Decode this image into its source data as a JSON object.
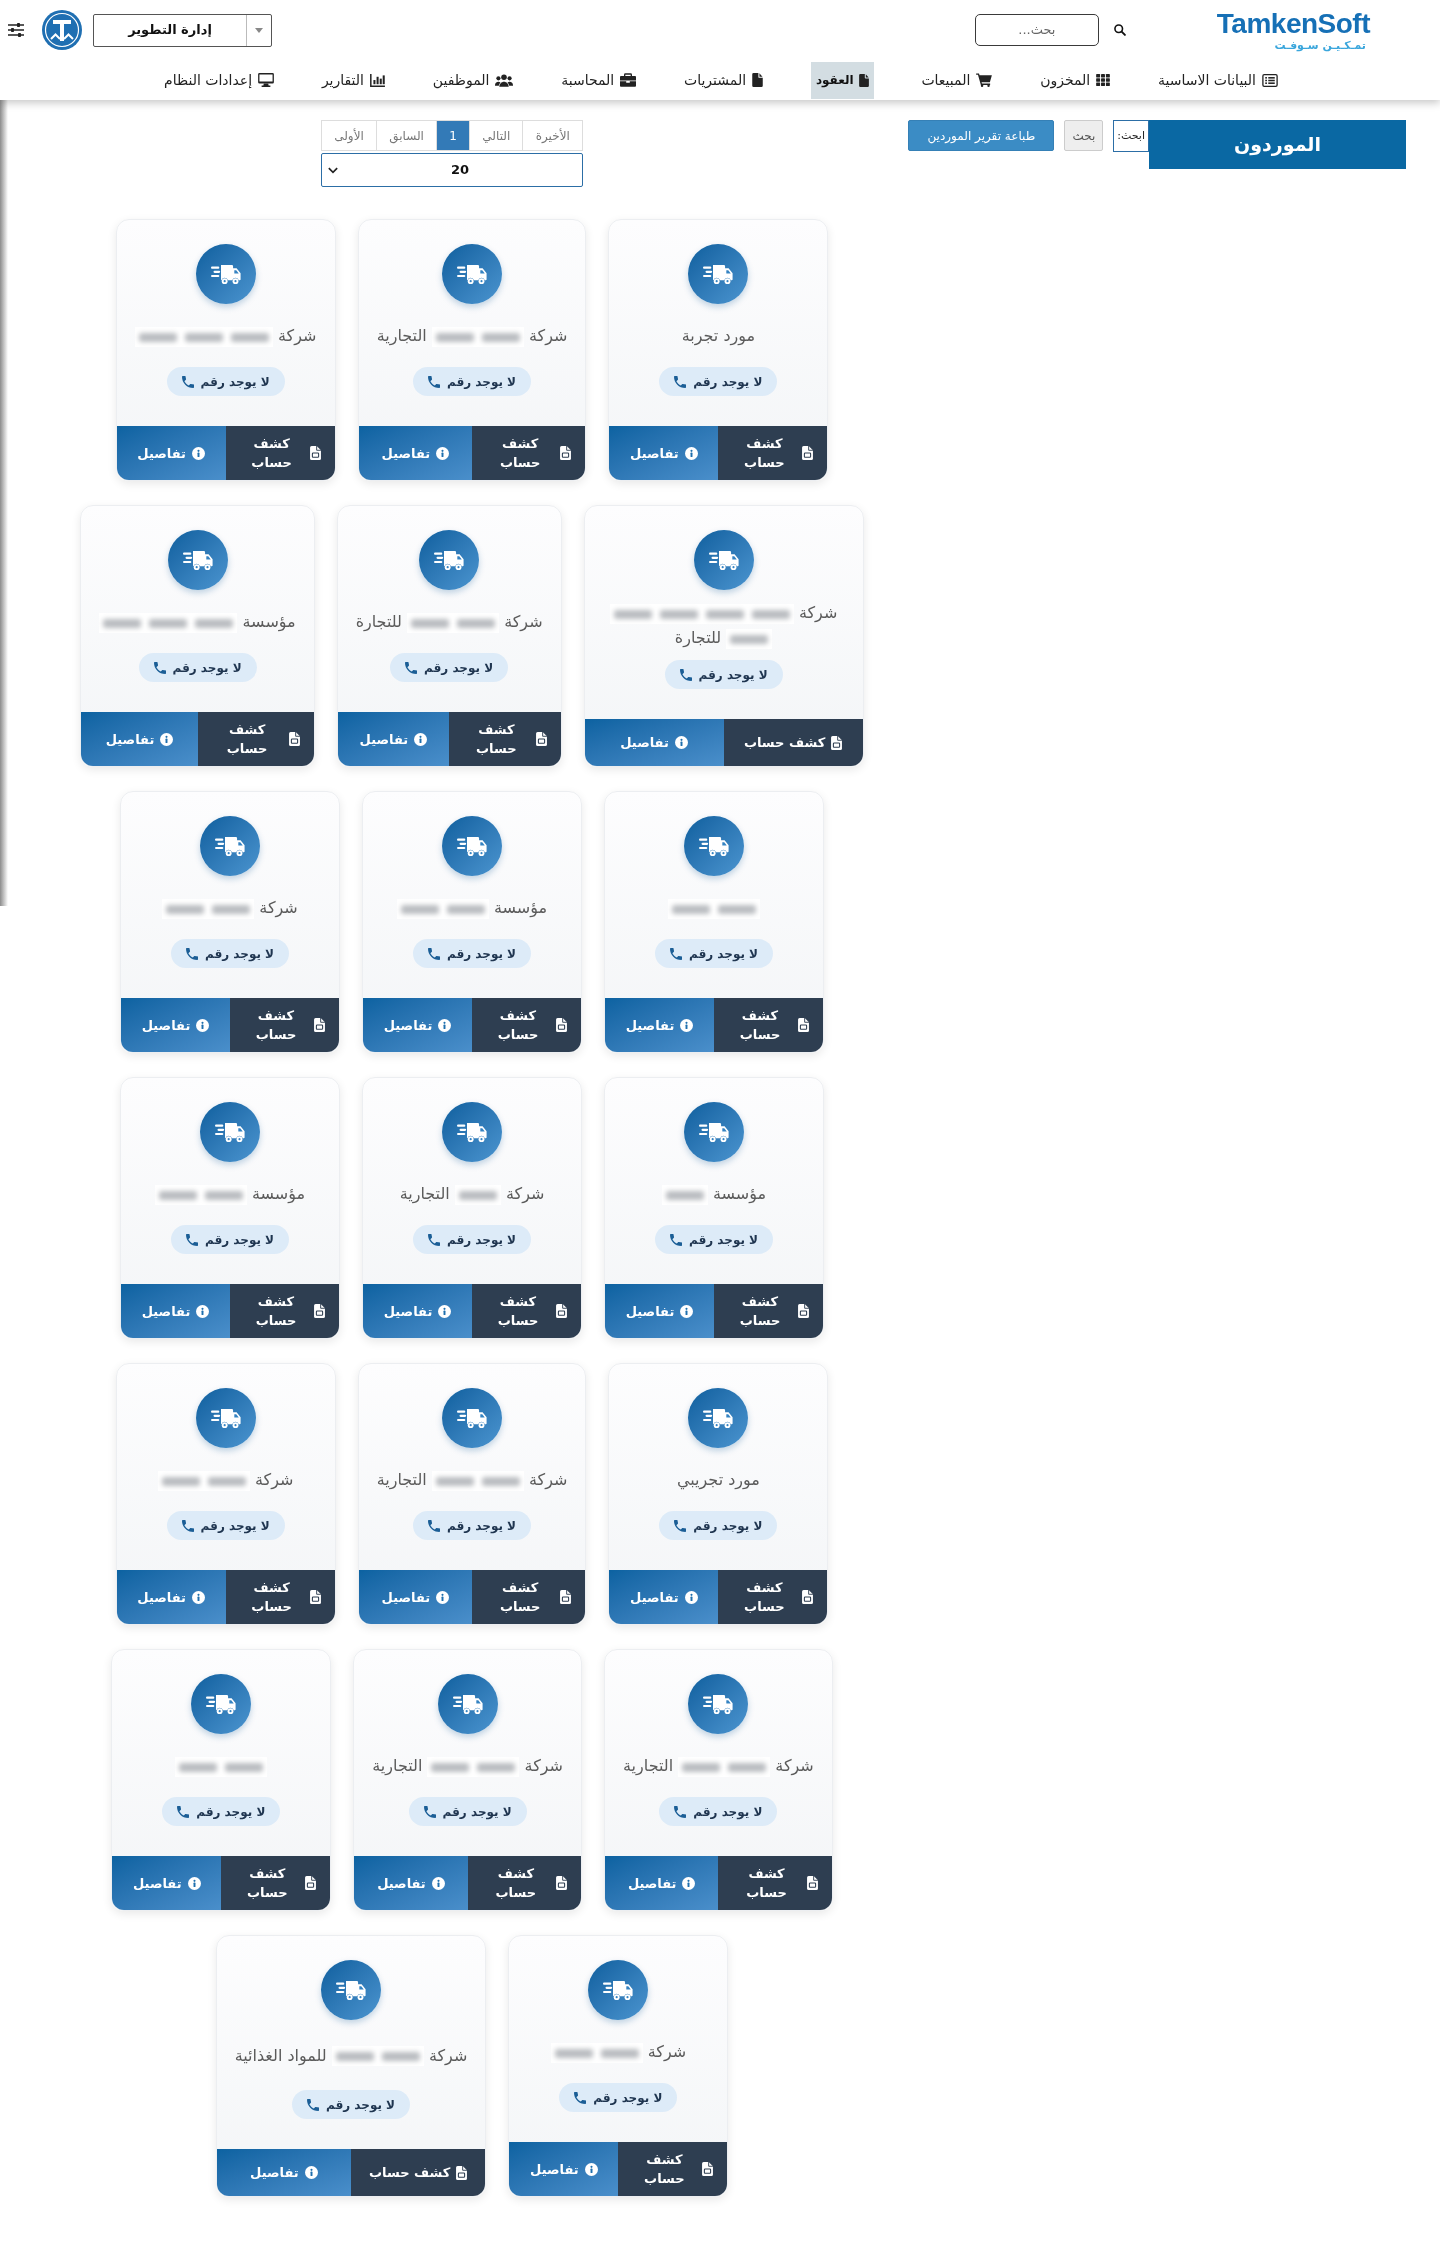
{
  "header": {
    "logo": {
      "text": "TamkenSoft",
      "subtitle": "تمـكـيـن سـوفـت"
    },
    "search": {
      "placeholder": "بحث..."
    },
    "department_select": {
      "value": "إدارة التطوير"
    }
  },
  "nav": [
    {
      "label": "البيانات الاساسية",
      "selected": false
    },
    {
      "label": "المخزون",
      "selected": false
    },
    {
      "label": "المبيعات",
      "selected": false
    },
    {
      "label": "العقود",
      "selected": true
    },
    {
      "label": "المشتريات",
      "selected": false
    },
    {
      "label": "المحاسبة",
      "selected": false
    },
    {
      "label": "الموظفين",
      "selected": false
    },
    {
      "label": "التقارير",
      "selected": false
    },
    {
      "label": "إعدادات النظام",
      "selected": false
    }
  ],
  "toolbar": {
    "title": "الموردون",
    "search_label": "ابحث:",
    "search_button": "بحث",
    "print_button": "طباعة تقرير الموردين"
  },
  "pagination": {
    "pages": [
      {
        "label": "الأخيرة",
        "selected": false
      },
      {
        "label": "التالي",
        "selected": false
      },
      {
        "label": "1",
        "selected": true
      },
      {
        "label": "السابق",
        "selected": false
      },
      {
        "label": "الأولى",
        "selected": false
      }
    ],
    "page_size": "20"
  },
  "suppliers": [
    {
      "name": [
        {
          "kind": "text",
          "text": "مورد تجربة"
        }
      ],
      "phone": "لا يوجد رقم",
      "statement_button": "كشف حساب",
      "details_button": "تفاصيل"
    },
    {
      "name": [
        {
          "kind": "text",
          "text": "شركة"
        },
        {
          "kind": "redacted"
        },
        {
          "kind": "redacted"
        },
        {
          "kind": "text",
          "text": "التجارية"
        }
      ],
      "phone": "لا يوجد رقم",
      "statement_button": "كشف حساب",
      "details_button": "تفاصيل"
    },
    {
      "name": [
        {
          "kind": "text",
          "text": "شركة"
        },
        {
          "kind": "redacted"
        },
        {
          "kind": "redacted"
        },
        {
          "kind": "redacted"
        }
      ],
      "phone": "لا يوجد رقم",
      "statement_button": "كشف حساب",
      "details_button": "تفاصيل"
    },
    {
      "name": [
        {
          "kind": "text",
          "text": "شركة"
        },
        {
          "kind": "redacted"
        },
        {
          "kind": "redacted"
        },
        {
          "kind": "redacted"
        },
        {
          "kind": "redacted"
        },
        {
          "kind": "redacted"
        },
        {
          "kind": "text",
          "text": "للتجارة"
        }
      ],
      "phone": "لا يوجد رقم",
      "statement_button": "كشف حساب",
      "details_button": "تفاصيل"
    },
    {
      "name": [
        {
          "kind": "text",
          "text": "شركة"
        },
        {
          "kind": "redacted"
        },
        {
          "kind": "redacted"
        },
        {
          "kind": "text",
          "text": "للتجارة"
        }
      ],
      "phone": "لا يوجد رقم",
      "statement_button": "كشف حساب",
      "details_button": "تفاصيل"
    },
    {
      "name": [
        {
          "kind": "text",
          "text": "مؤسسة"
        },
        {
          "kind": "redacted"
        },
        {
          "kind": "redacted"
        },
        {
          "kind": "redacted"
        }
      ],
      "phone": "لا يوجد رقم",
      "statement_button": "كشف حساب",
      "details_button": "تفاصيل"
    },
    {
      "name": [
        {
          "kind": "redacted"
        },
        {
          "kind": "redacted"
        }
      ],
      "phone": "لا يوجد رقم",
      "statement_button": "كشف حساب",
      "details_button": "تفاصيل"
    },
    {
      "name": [
        {
          "kind": "text",
          "text": "مؤسسة"
        },
        {
          "kind": "redacted"
        },
        {
          "kind": "redacted"
        }
      ],
      "phone": "لا يوجد رقم",
      "statement_button": "كشف حساب",
      "details_button": "تفاصيل"
    },
    {
      "name": [
        {
          "kind": "text",
          "text": "شركة"
        },
        {
          "kind": "redacted"
        },
        {
          "kind": "redacted"
        }
      ],
      "phone": "لا يوجد رقم",
      "statement_button": "كشف حساب",
      "details_button": "تفاصيل"
    },
    {
      "name": [
        {
          "kind": "text",
          "text": "مؤسسة"
        },
        {
          "kind": "redacted"
        }
      ],
      "phone": "لا يوجد رقم",
      "statement_button": "كشف حساب",
      "details_button": "تفاصيل"
    },
    {
      "name": [
        {
          "kind": "text",
          "text": "شركة"
        },
        {
          "kind": "redacted"
        },
        {
          "kind": "text",
          "text": "التجارية"
        }
      ],
      "phone": "لا يوجد رقم",
      "statement_button": "كشف حساب",
      "details_button": "تفاصيل"
    },
    {
      "name": [
        {
          "kind": "text",
          "text": "مؤسسة"
        },
        {
          "kind": "redacted"
        },
        {
          "kind": "redacted"
        }
      ],
      "phone": "لا يوجد رقم",
      "statement_button": "كشف حساب",
      "details_button": "تفاصيل"
    },
    {
      "name": [
        {
          "kind": "text",
          "text": "مورد تجريبي"
        }
      ],
      "phone": "لا يوجد رقم",
      "statement_button": "كشف حساب",
      "details_button": "تفاصيل"
    },
    {
      "name": [
        {
          "kind": "text",
          "text": "شركة"
        },
        {
          "kind": "redacted"
        },
        {
          "kind": "redacted"
        },
        {
          "kind": "text",
          "text": "التجارية"
        }
      ],
      "phone": "لا يوجد رقم",
      "statement_button": "كشف حساب",
      "details_button": "تفاصيل"
    },
    {
      "name": [
        {
          "kind": "text",
          "text": "شركة"
        },
        {
          "kind": "redacted"
        },
        {
          "kind": "redacted"
        }
      ],
      "phone": "لا يوجد رقم",
      "statement_button": "كشف حساب",
      "details_button": "تفاصيل"
    },
    {
      "name": [
        {
          "kind": "text",
          "text": "شركة"
        },
        {
          "kind": "redacted"
        },
        {
          "kind": "redacted"
        },
        {
          "kind": "text",
          "text": "التجارية"
        }
      ],
      "phone": "لا يوجد رقم",
      "statement_button": "كشف حساب",
      "details_button": "تفاصيل"
    },
    {
      "name": [
        {
          "kind": "text",
          "text": "شركة"
        },
        {
          "kind": "redacted"
        },
        {
          "kind": "redacted"
        },
        {
          "kind": "text",
          "text": "التجارية"
        }
      ],
      "phone": "لا يوجد رقم",
      "statement_button": "كشف حساب",
      "details_button": "تفاصيل"
    },
    {
      "name": [
        {
          "kind": "redacted"
        },
        {
          "kind": "redacted"
        }
      ],
      "phone": "لا يوجد رقم",
      "statement_button": "كشف حساب",
      "details_button": "تفاصيل"
    },
    {
      "name": [
        {
          "kind": "text",
          "text": "شركة"
        },
        {
          "kind": "redacted"
        },
        {
          "kind": "redacted"
        }
      ],
      "phone": "لا يوجد رقم",
      "statement_button": "كشف حساب",
      "details_button": "تفاصيل"
    },
    {
      "name": [
        {
          "kind": "text",
          "text": "شركة"
        },
        {
          "kind": "redacted"
        },
        {
          "kind": "redacted"
        },
        {
          "kind": "text",
          "text": "للمواد الغذائية"
        }
      ],
      "phone": "لا يوجد رقم",
      "statement_button": "كشف حساب",
      "details_button": "تفاصيل"
    }
  ]
}
